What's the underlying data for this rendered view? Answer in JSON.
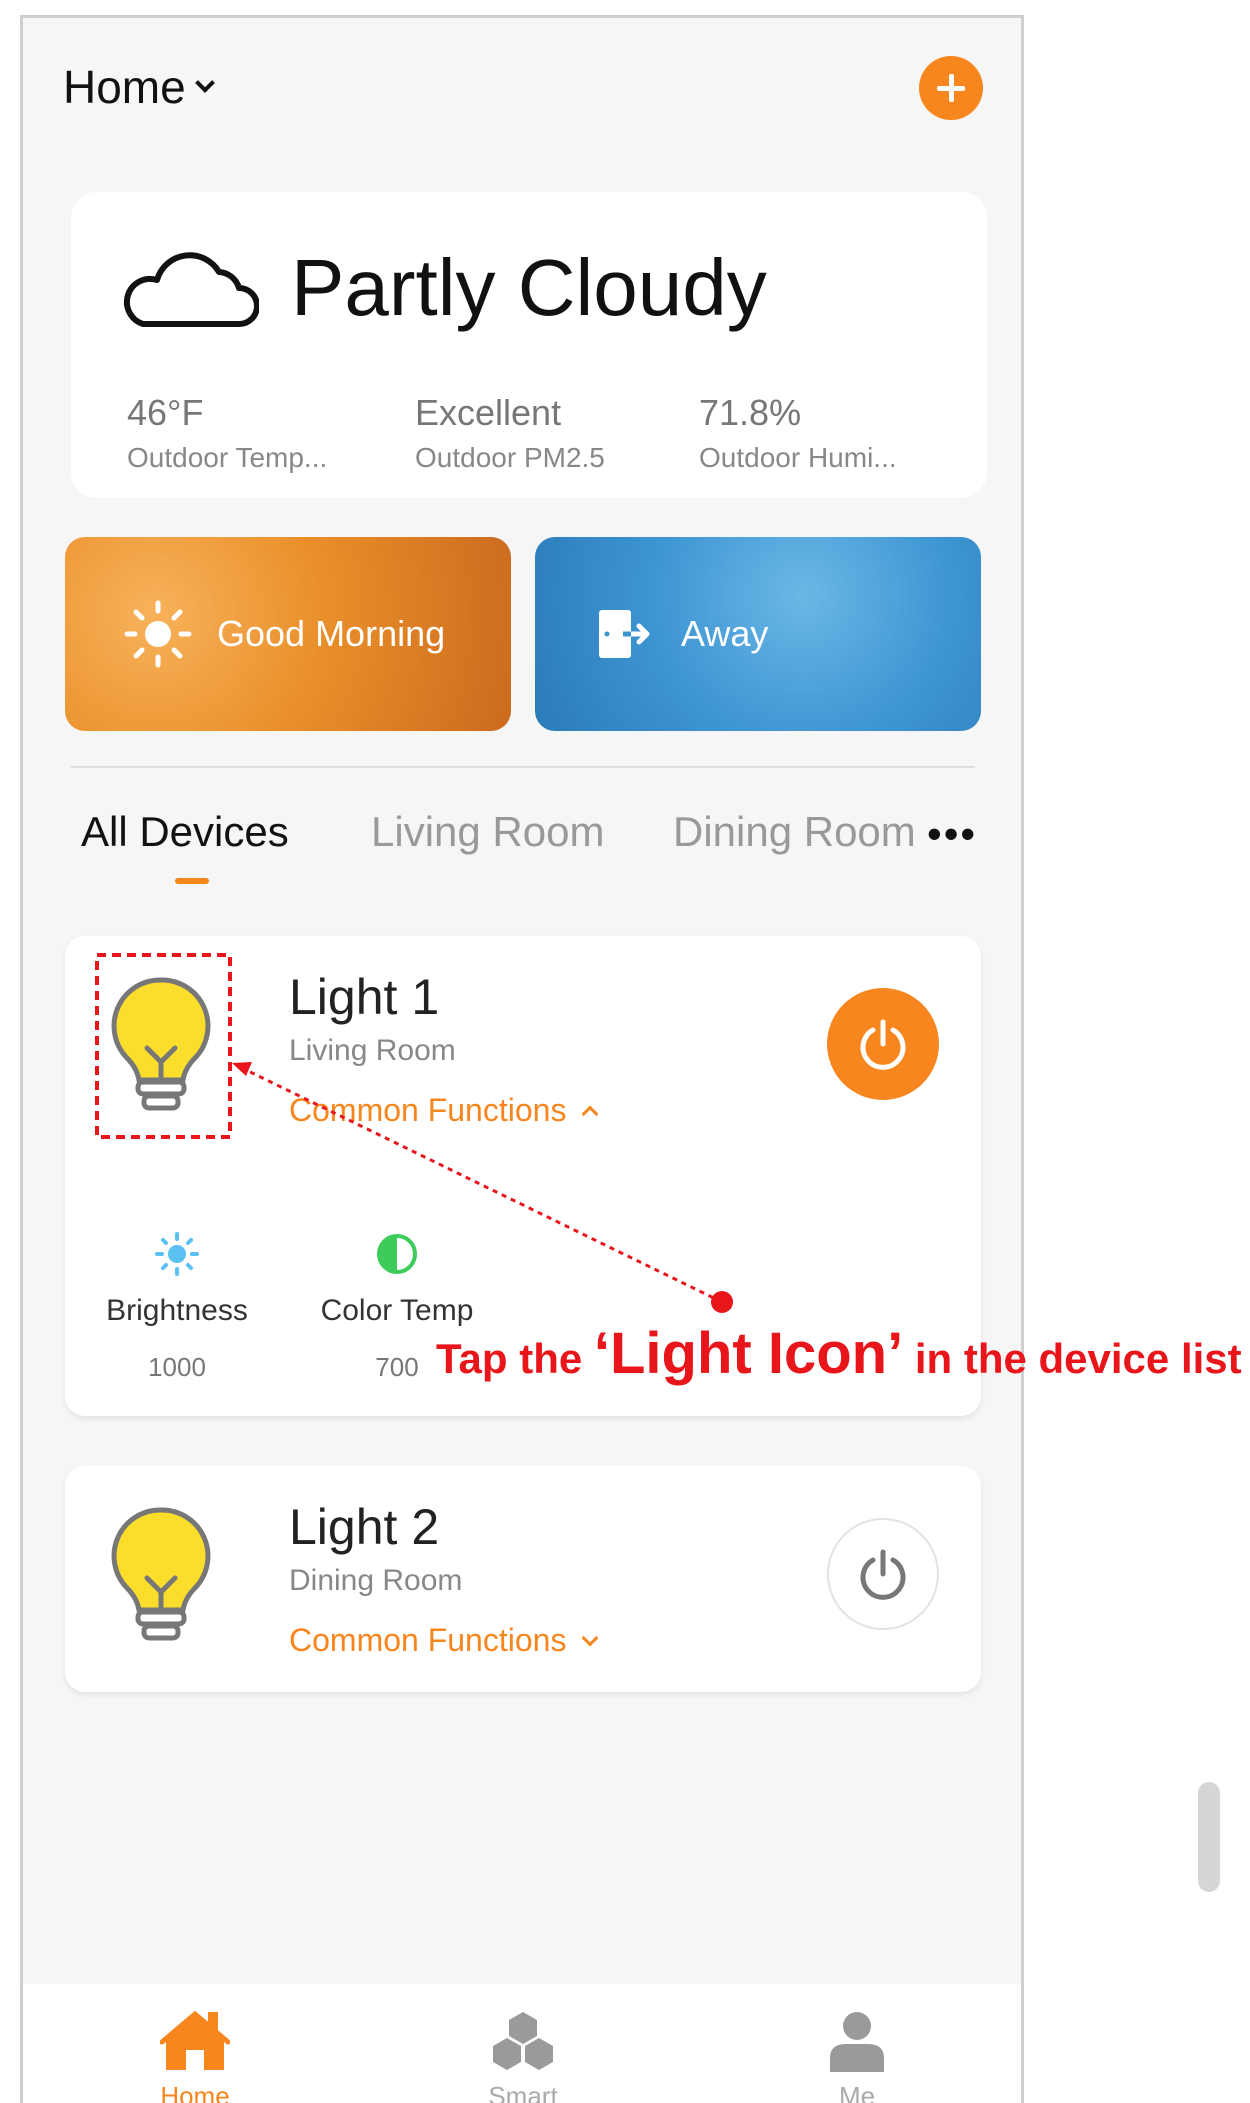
{
  "header": {
    "title": "Home"
  },
  "weather": {
    "condition": "Partly Cloudy",
    "stats": [
      {
        "value": "46°F",
        "label": "Outdoor Temp..."
      },
      {
        "value": "Excellent",
        "label": "Outdoor PM2.5"
      },
      {
        "value": "71.8%",
        "label": "Outdoor Humi..."
      }
    ]
  },
  "scenes": [
    {
      "label": "Good Morning",
      "icon": "sun-icon"
    },
    {
      "label": "Away",
      "icon": "leave-home-icon"
    }
  ],
  "tabs": [
    "All Devices",
    "Living Room",
    "Dining Room"
  ],
  "devices": [
    {
      "name": "Light 1",
      "room": "Living Room",
      "functions_label": "Common Functions",
      "power": "on",
      "functions": [
        {
          "label": "Brightness",
          "value": "1000",
          "icon": "brightness-icon"
        },
        {
          "label": "Color Temp",
          "value": "700",
          "icon": "color-temp-icon"
        }
      ]
    },
    {
      "name": "Light 2",
      "room": "Dining Room",
      "functions_label": "Common Functions",
      "power": "off"
    }
  ],
  "nav": [
    {
      "label": "Home",
      "icon": "home-icon",
      "active": true
    },
    {
      "label": "Smart",
      "icon": "smart-icon",
      "active": false
    },
    {
      "label": "Me",
      "icon": "user-icon",
      "active": false
    }
  ],
  "annotation": {
    "text_before": "Tap the ",
    "text_highlight": "‘Light Icon’",
    "text_after": " in the device list"
  },
  "colors": {
    "accent": "#f7861e",
    "annotation": "#e8151b",
    "bulb": "#fbdd2c"
  }
}
